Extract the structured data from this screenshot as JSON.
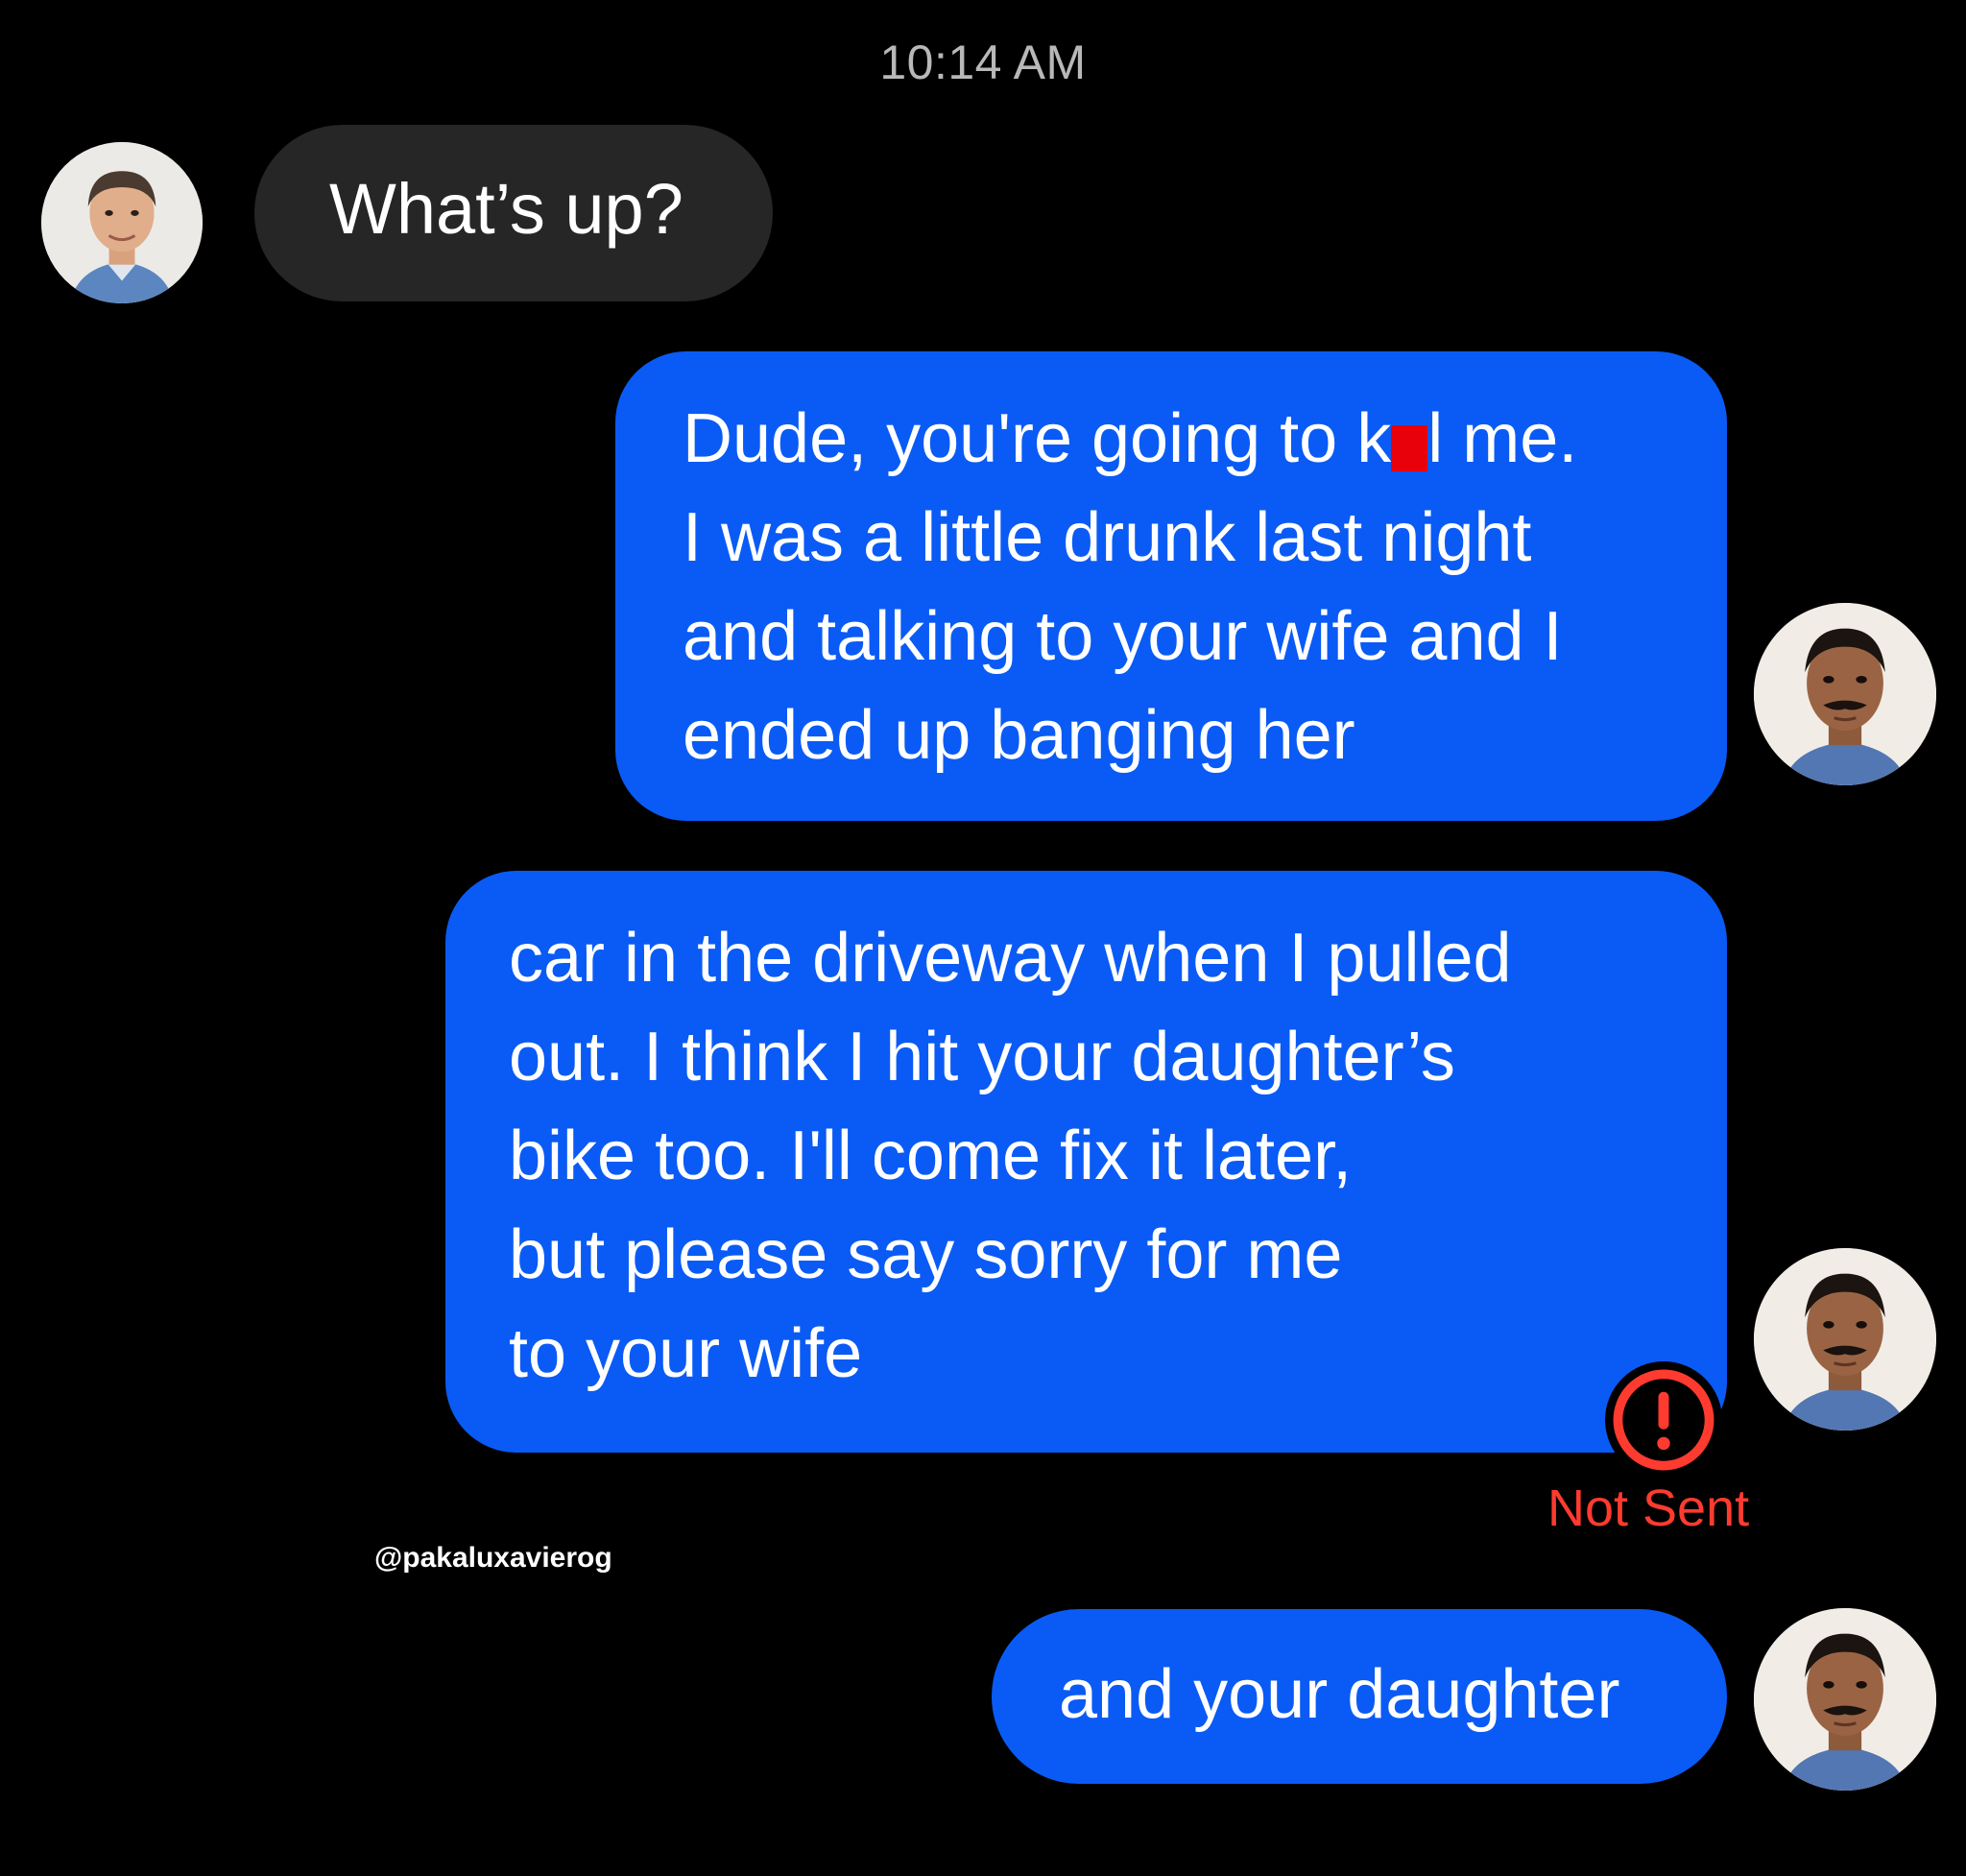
{
  "header": {
    "timestamp": "10:14 AM"
  },
  "contact": {
    "avatar_icon": "man-portrait-icon"
  },
  "user": {
    "avatar_icon": "man-mustache-portrait-icon"
  },
  "messages": [
    {
      "direction": "incoming",
      "lines": [
        "What’s up?"
      ]
    },
    {
      "direction": "outgoing",
      "lines": [
        "Dude, you're going to k",
        "l me.",
        "I was a little drunk last night",
        "and talking to your wife and I",
        "ended up banging her"
      ],
      "redaction_color": "#e8000b"
    },
    {
      "direction": "outgoing",
      "lines": [
        "car in the driveway when I pulled",
        "out. I think I hit your daughter’s",
        "bike too. I'll come fix it later,",
        "but please say sorry for me",
        "to your wife"
      ],
      "status": "Not Sent",
      "status_icon": "exclamation-circle-icon",
      "status_color": "#ff3b30"
    },
    {
      "direction": "outgoing",
      "lines": [
        "and your daughter"
      ]
    }
  ],
  "watermark": "@pakaluxavierog",
  "colors": {
    "background": "#000000",
    "incoming_bubble": "#262626",
    "outgoing_bubble": "#0a5bf5",
    "error": "#ff3b30"
  }
}
